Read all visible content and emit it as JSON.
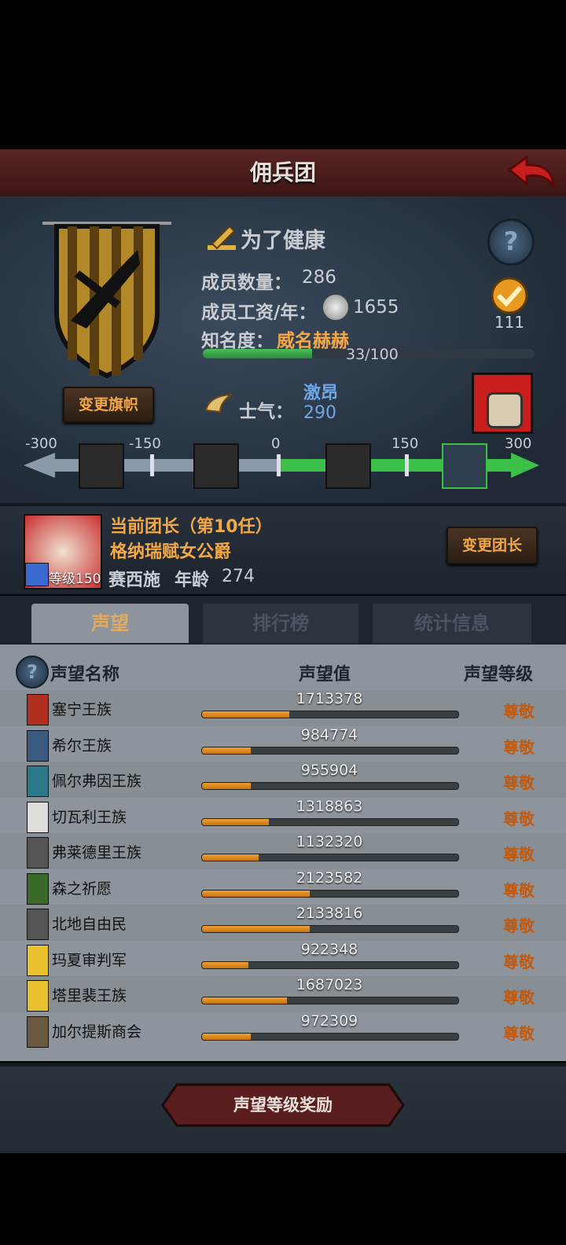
{
  "header": {
    "title": "佣兵团"
  },
  "company": {
    "name": "为了健康",
    "members_label": "成员数量：",
    "members": "286",
    "salary_label": "成员工资/年：",
    "salary": "1655",
    "fame_label": "知名度：",
    "fame_value": "威名赫赫",
    "fame_progress": "33/100",
    "fame_fraction": 0.33,
    "rank_number": "111",
    "change_banner": "变更旗帜",
    "morale_label": "士气：",
    "morale_state": "激昂",
    "morale_value": "290",
    "morale_ticks": [
      "-300",
      "-150",
      "0",
      "150",
      "300"
    ]
  },
  "leader": {
    "title": "当前团长（第10任）",
    "noble": "格纳瑞赋女公爵",
    "level_label": "等级",
    "level": "150",
    "name": "赛西施",
    "age_label": "年龄",
    "age": "274",
    "change_leader": "变更团长"
  },
  "tabs": [
    "声望",
    "排行榜",
    "统计信息"
  ],
  "table": {
    "headers": [
      "声望名称",
      "声望值",
      "声望等级"
    ],
    "rows": [
      {
        "name": "塞宁王族",
        "value": "1713378",
        "level": "尊敬",
        "fraction": 0.34
      },
      {
        "name": "希尔王族",
        "value": "984774",
        "level": "尊敬",
        "fraction": 0.19
      },
      {
        "name": "佩尔弗因王族",
        "value": "955904",
        "level": "尊敬",
        "fraction": 0.19
      },
      {
        "name": "切瓦利王族",
        "value": "1318863",
        "level": "尊敬",
        "fraction": 0.26
      },
      {
        "name": "弗莱德里王族",
        "value": "1132320",
        "level": "尊敬",
        "fraction": 0.22
      },
      {
        "name": "森之祈愿",
        "value": "2123582",
        "level": "尊敬",
        "fraction": 0.42
      },
      {
        "name": "北地自由民",
        "value": "2133816",
        "level": "尊敬",
        "fraction": 0.42
      },
      {
        "name": "玛夏审判军",
        "value": "922348",
        "level": "尊敬",
        "fraction": 0.18
      },
      {
        "name": "塔里裴王族",
        "value": "1687023",
        "level": "尊敬",
        "fraction": 0.33
      },
      {
        "name": "加尔提斯商会",
        "value": "972309",
        "level": "尊敬",
        "fraction": 0.19
      }
    ]
  },
  "footer": {
    "reward_button": "声望等级奖励"
  },
  "colors": {
    "accent": "#f2a848",
    "morale_green": "#3cc04a",
    "level_text": "#c05a10"
  }
}
